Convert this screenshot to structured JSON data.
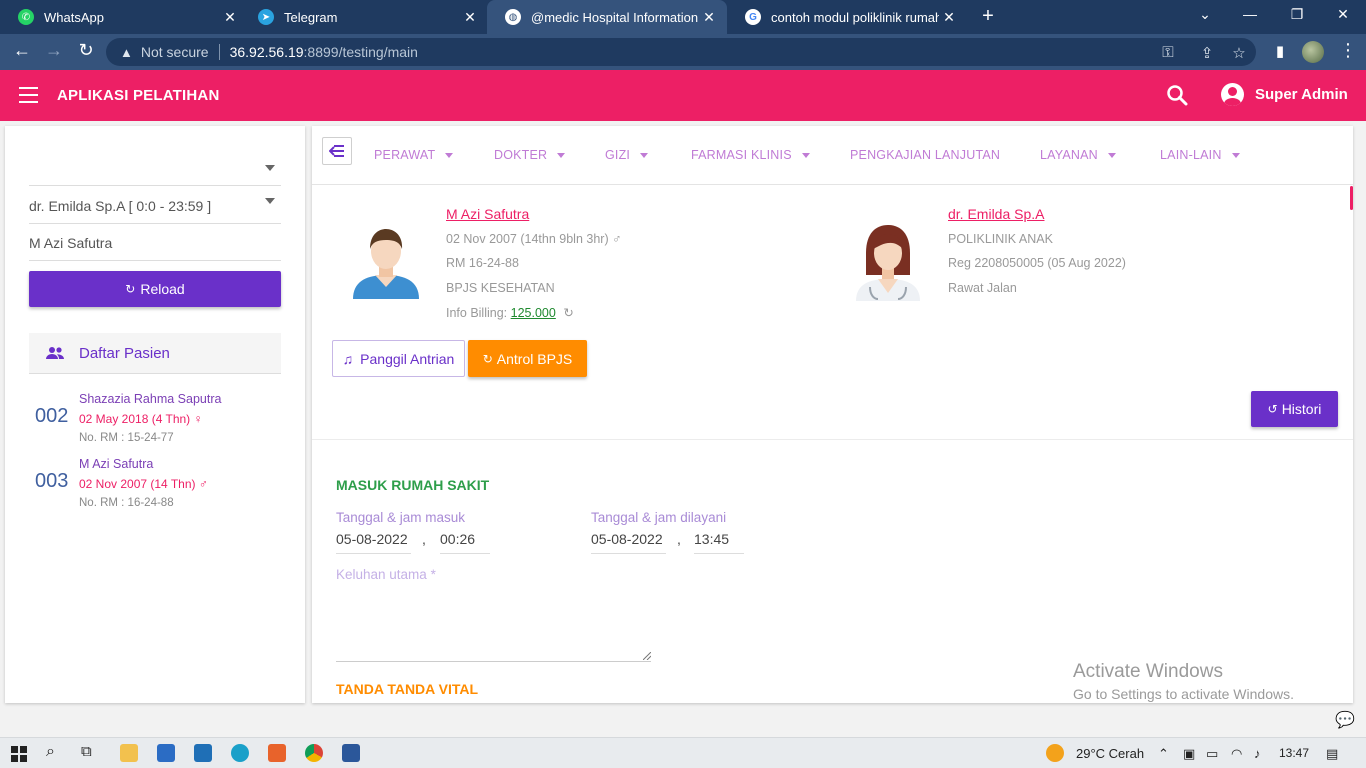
{
  "browser": {
    "tabs": [
      {
        "label": "WhatsApp",
        "icon": "whatsapp-icon",
        "active": false
      },
      {
        "label": "Telegram",
        "icon": "telegram-icon",
        "active": false
      },
      {
        "label": "@medic Hospital Information Sys",
        "icon": "globe-icon",
        "active": true
      },
      {
        "label": "contoh modul poliklinik rumah s",
        "icon": "google-icon",
        "active": false
      }
    ],
    "security_label": "Not secure",
    "url_host": "36.92.56.19",
    "url_path": ":8899/testing/main"
  },
  "app": {
    "title": "APLIKASI PELATIHAN",
    "user_name": "Super Admin",
    "accent_color": "#ed1f65",
    "primary_color": "#6a30c9"
  },
  "sidebar": {
    "select1_value": "",
    "doctor_select_value": "dr. Emilda Sp.A [ 0:0 - 23:59 ]",
    "patient_search_value": "M Azi Safutra",
    "reload_label": "Reload",
    "patient_list_title": "Daftar Pasien",
    "patients": [
      {
        "number": "002",
        "name": "Shazazia Rahma Saputra",
        "dob": "02 May 2018 (4 Thn) ♀",
        "rm": "No. RM : 15-24-77"
      },
      {
        "number": "003",
        "name": "M Azi Safutra",
        "dob": "02 Nov 2007 (14 Thn) ♂",
        "rm": "No. RM : 16-24-88"
      }
    ]
  },
  "nav": {
    "items": [
      {
        "label": "PERAWAT",
        "dropdown": true
      },
      {
        "label": "DOKTER",
        "dropdown": true
      },
      {
        "label": "GIZI",
        "dropdown": true
      },
      {
        "label": "FARMASI KLINIS",
        "dropdown": true
      },
      {
        "label": "PENGKAJIAN LANJUTAN",
        "dropdown": false
      },
      {
        "label": "LAYANAN",
        "dropdown": true
      },
      {
        "label": "LAIN-LAIN",
        "dropdown": true
      }
    ]
  },
  "patient": {
    "name": "M Azi Safutra",
    "dob": "02 Nov 2007 (14thn 9bln 3hr) ♂",
    "rm": "RM 16-24-88",
    "payer": "BPJS KESEHATAN",
    "billing_label": "Info Billing:",
    "billing_value": "125.000"
  },
  "doctor": {
    "name": "dr. Emilda Sp.A",
    "clinic": "POLIKLINIK ANAK",
    "reg": "Reg 2208050005 (05 Aug 2022)",
    "type": "Rawat Jalan"
  },
  "actions": {
    "panggil_label": "Panggil Antrian",
    "antrol_label": "Antrol BPJS",
    "histori_label": "Histori"
  },
  "form": {
    "section_title": "MASUK RUMAH SAKIT",
    "masuk_label": "Tanggal & jam masuk",
    "masuk_date": "05-08-2022",
    "masuk_time": "00:26",
    "dilayani_label": "Tanggal & jam dilayani",
    "dilayani_date": "05-08-2022",
    "dilayani_time": "13:45",
    "keluhan_label": "Keluhan utama *",
    "vital_title": "TANDA TANDA VITAL"
  },
  "watermark": {
    "line1": "Activate Windows",
    "line2": "Go to Settings to activate Windows."
  },
  "taskbar": {
    "weather": "29°C  Cerah",
    "time": "13:47"
  }
}
